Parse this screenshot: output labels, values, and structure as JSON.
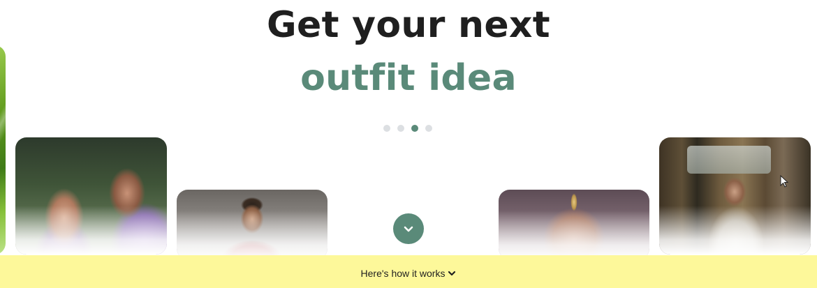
{
  "headline": {
    "line1": "Get your next",
    "line2": "outfit idea",
    "accent_color": "#5a8a79"
  },
  "carousel": {
    "dot_count": 4,
    "active_index": 2
  },
  "cards": [
    {
      "name": "leaf-image",
      "subject": "green leaves"
    },
    {
      "name": "couple-image",
      "subject": "couple"
    },
    {
      "name": "man-image",
      "subject": "man in red"
    },
    {
      "name": "jewelry-image",
      "subject": "woman with jewelry"
    },
    {
      "name": "saree-image",
      "subject": "woman in saree"
    }
  ],
  "scroll_button": {
    "icon": "chevron-down-icon",
    "color": "#5a8a79"
  },
  "info_bar": {
    "label": "Here's how it works",
    "icon": "chevron-down-icon",
    "background": "#fdf89a"
  }
}
